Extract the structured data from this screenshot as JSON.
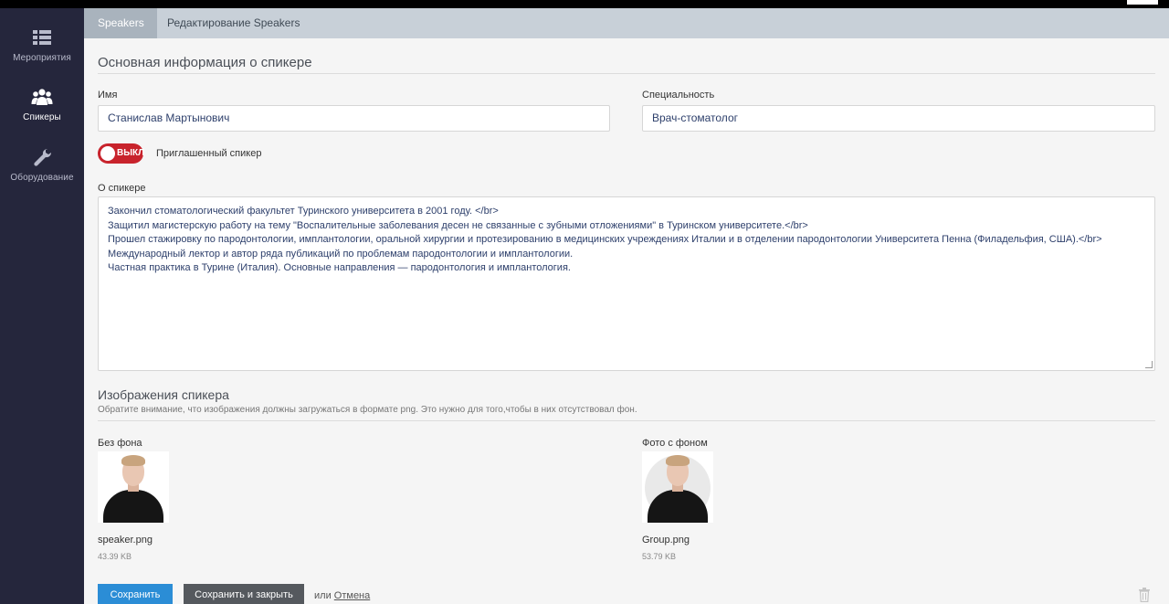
{
  "sidebar": {
    "items": [
      {
        "label": "Мероприятия",
        "icon": "list-icon"
      },
      {
        "label": "Спикеры",
        "icon": "users-icon"
      },
      {
        "label": "Оборудование",
        "icon": "wrench-icon"
      }
    ]
  },
  "breadcrumb": {
    "first": "Speakers",
    "second": "Редактирование Speakers"
  },
  "main_section": {
    "title": "Основная информация о спикере"
  },
  "form": {
    "name_label": "Имя",
    "name_value": "Станислав Мартынович",
    "specialty_label": "Специальность",
    "specialty_value": "Врач-стоматолог",
    "toggle_text": "ВЫКЛ",
    "toggle_label": "Приглашенный спикер",
    "about_label": "О спикере",
    "about_lines": [
      "Закончил стоматологический факультет Туринского университета в 2001 году. </br>",
      "Защитил магистерскую работу на тему \"Воспалительные заболевания десен не связанные с зубными отложениями\" в Туринском университете.</br>",
      "Прошел стажировку по пародонтологии, имплантологии, оральной хирургии и протезированию в медицинских учреждениях Италии и в отделении пародонтологии Университета Пенна (Филадельфия, США).</br>",
      "Международный лектор и автор ряда публикаций по проблемам пародонтологии и имплантологии.",
      "Частная практика в Турине (Италия). Основные направления — пародонтология и имплантология."
    ]
  },
  "images_section": {
    "title": "Изображения спикера",
    "note": "Обратите внимание, что изображения должны загружаться в формате png. Это нужно для того,чтобы в них отсутствовал фон.",
    "no_bg_label": "Без фона",
    "no_bg_file": "speaker.png",
    "no_bg_size": "43.39 KB",
    "with_bg_label": "Фото с фоном",
    "with_bg_file": "Group.png",
    "with_bg_size": "53.79 KB"
  },
  "actions": {
    "save": "Сохранить",
    "save_close": "Сохранить и закрыть",
    "or": "или",
    "cancel": "Отмена"
  },
  "colors": {
    "sidebar_bg": "#25263c",
    "accent_blue": "#2b8dd6",
    "toggle_red": "#c8232c"
  }
}
